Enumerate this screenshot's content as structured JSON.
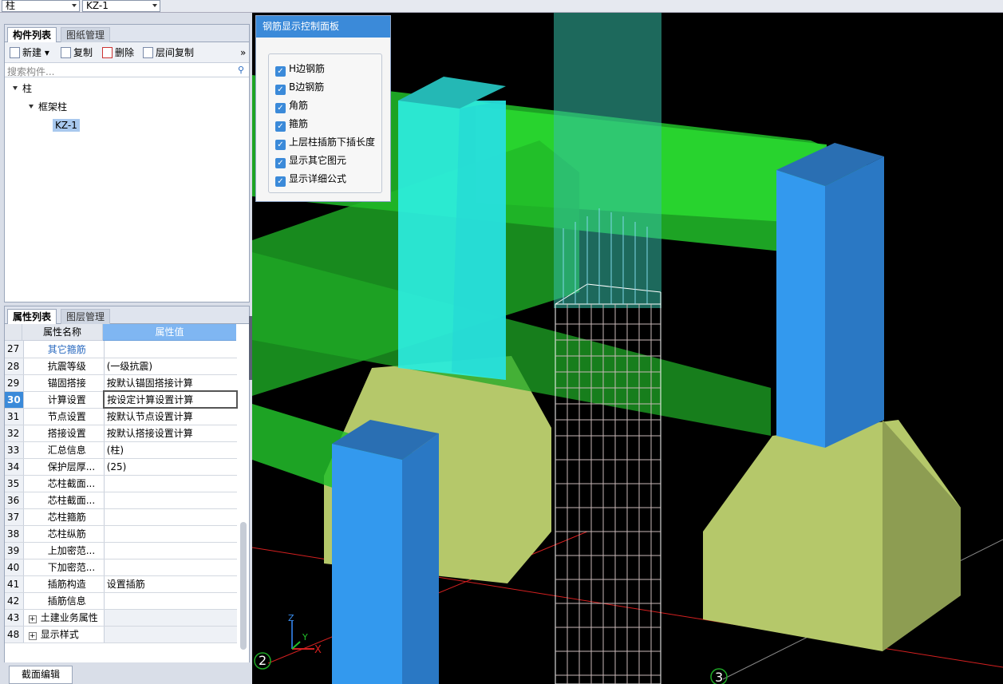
{
  "top": {
    "combo1": "柱",
    "combo2": "KZ-1"
  },
  "component_panel": {
    "tabs": [
      "构件列表",
      "图纸管理"
    ],
    "toolbar": {
      "new": "新建",
      "copy": "复制",
      "delete": "删除",
      "floor_copy": "层间复制"
    },
    "search_placeholder": "搜索构件...",
    "tree": {
      "root": "柱",
      "group": "框架柱",
      "item": "KZ-1"
    }
  },
  "property_panel": {
    "tabs": [
      "属性列表",
      "图层管理"
    ],
    "header": {
      "name": "属性名称",
      "value": "属性值"
    },
    "rows": [
      {
        "num": "27",
        "name": "其它箍筋",
        "value": ""
      },
      {
        "num": "28",
        "name": "抗震等级",
        "value": "(一级抗震)"
      },
      {
        "num": "29",
        "name": "锚固搭接",
        "value": "按默认锚固搭接计算"
      },
      {
        "num": "30",
        "name": "计算设置",
        "value": "按设定计算设置计算"
      },
      {
        "num": "31",
        "name": "节点设置",
        "value": "按默认节点设置计算"
      },
      {
        "num": "32",
        "name": "搭接设置",
        "value": "按默认搭接设置计算"
      },
      {
        "num": "33",
        "name": "汇总信息",
        "value": "(柱)"
      },
      {
        "num": "34",
        "name": "保护层厚...",
        "value": "(25)"
      },
      {
        "num": "35",
        "name": "芯柱截面...",
        "value": ""
      },
      {
        "num": "36",
        "name": "芯柱截面...",
        "value": ""
      },
      {
        "num": "37",
        "name": "芯柱箍筋",
        "value": ""
      },
      {
        "num": "38",
        "name": "芯柱纵筋",
        "value": ""
      },
      {
        "num": "39",
        "name": "上加密范...",
        "value": ""
      },
      {
        "num": "40",
        "name": "下加密范...",
        "value": ""
      },
      {
        "num": "41",
        "name": "插筋构造",
        "value": "设置插筋"
      },
      {
        "num": "42",
        "name": "插筋信息",
        "value": ""
      },
      {
        "num": "43",
        "name": "土建业务属性",
        "value": ""
      },
      {
        "num": "48",
        "name": "显示样式",
        "value": ""
      }
    ]
  },
  "bottom": {
    "section_edit": "截面编辑"
  },
  "rebar_panel": {
    "title": "钢筋显示控制面板",
    "options": [
      "H边钢筋",
      "B边钢筋",
      "角筋",
      "箍筋",
      "上层柱插筋下插长度",
      "显示其它图元",
      "显示详细公式"
    ]
  },
  "viewport": {
    "axis_labels": {
      "z": "Z",
      "y": "Y",
      "x": "X"
    },
    "grid_labels": [
      "2",
      "3"
    ]
  },
  "colors": {
    "beam": "#22c02a",
    "column_blue": "#3399ee",
    "column_cyan": "#2ef3f0",
    "footing": "#b5c86a",
    "accent": "#3b8ad9"
  }
}
